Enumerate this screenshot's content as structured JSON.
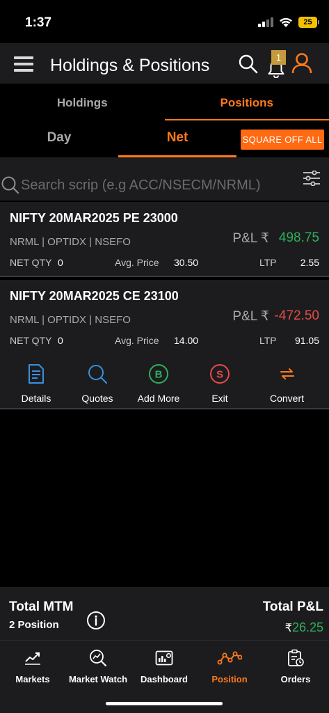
{
  "status_bar": {
    "time": "1:37",
    "battery": "25"
  },
  "header": {
    "title": "Holdings & Positions",
    "notification_count": "1"
  },
  "main_tabs": [
    {
      "label": "Holdings",
      "active": false
    },
    {
      "label": "Positions",
      "active": true
    }
  ],
  "sub_tabs": {
    "day": "Day",
    "net": "Net",
    "square_off": "SQUARE OFF ALL"
  },
  "search": {
    "placeholder": "Search scrip (e.g ACC/NSECM/NRML)"
  },
  "positions": [
    {
      "name": "NIFTY 20MAR2025 PE 23000",
      "meta": "NRML | OPTIDX |  NSEFO",
      "pnl_label": "P&L ₹",
      "pnl": "498.75",
      "net_qty_label": "NET QTY",
      "net_qty": "0",
      "avg_label": "Avg. Price",
      "avg_price": "30.50",
      "ltp_label": "LTP",
      "ltp": "2.55"
    },
    {
      "name": "NIFTY 20MAR2025 CE 23100",
      "meta": "NRML | OPTIDX |  NSEFO",
      "pnl_label": "P&L ₹",
      "pnl": "-472.50",
      "net_qty_label": "NET QTY",
      "net_qty": "0",
      "avg_label": "Avg. Price",
      "avg_price": "14.00",
      "ltp_label": "LTP",
      "ltp": "91.05"
    }
  ],
  "actions": {
    "details": "Details",
    "quotes": "Quotes",
    "add_more": "Add More",
    "add_more_glyph": "B",
    "exit": "Exit",
    "exit_glyph": "S",
    "convert": "Convert"
  },
  "summary": {
    "mtm_title": "Total MTM",
    "position_count": "2 Position",
    "pnl_title": "Total P&L",
    "currency": "₹",
    "total_pnl": "26.25"
  },
  "bottom_nav": {
    "markets": "Markets",
    "market_watch": "Market Watch",
    "dashboard": "Dashboard",
    "position": "Position",
    "orders": "Orders",
    "active": "Position"
  },
  "colors": {
    "accent": "#ff7a1a",
    "profit": "#2eb05a",
    "loss": "#e54b4b",
    "surface": "#1c1c1e"
  }
}
